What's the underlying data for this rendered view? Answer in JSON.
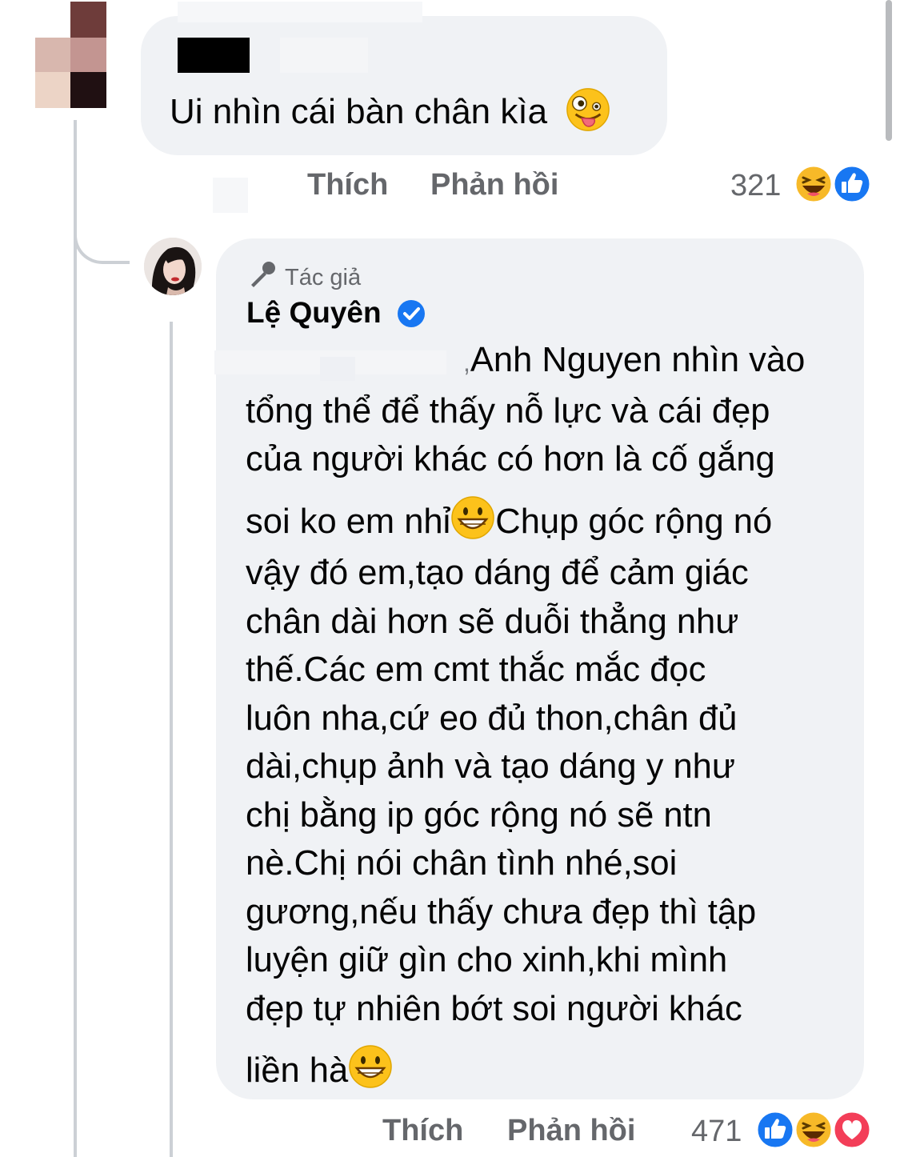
{
  "comment1": {
    "text": "Ui nhìn cái bàn chân kìa",
    "emoji": "zany-face",
    "actions": {
      "like": "Thích",
      "reply": "Phản hồi"
    },
    "reaction_count": "321",
    "reactions": [
      "haha",
      "like"
    ]
  },
  "reply": {
    "author_badge": "Tác giả",
    "author_name": "Lệ Quyên",
    "verified": true,
    "mention": "Anh Nguyen",
    "text_lines": [
      " nhìn vào",
      "tổng thể để thấy nỗ lực và cái đẹp",
      "của người khác có hơn là cố gắng",
      "soi ko em nhỉ",
      "Chụp góc rộng nó",
      "vậy đó em,tạo dáng để cảm giác",
      "chân dài hơn sẽ duỗi thẳng như",
      "thế.Các em cmt thắc mắc đọc",
      "luôn nha,cứ eo đủ thon,chân đủ",
      "dài,chụp ảnh và tạo dáng y như",
      "chị bằng ip góc rộng nó sẽ ntn",
      "nè.Chị nói chân tình nhé,soi",
      "gương,nếu thấy chưa đẹp thì tập",
      "luyện giữ gìn cho xinh,khi mình",
      "đẹp tự nhiên bớt soi người khác",
      "liền hà"
    ],
    "actions": {
      "like": "Thích",
      "reply": "Phản hồi"
    },
    "reaction_count": "471",
    "reactions": [
      "like",
      "haha",
      "love"
    ]
  },
  "colors": {
    "bubble": "#f0f2f5",
    "meta_text": "#65676b",
    "like_blue": "#1877f2",
    "haha_yellow": "#f7b928",
    "love_red": "#f33e58"
  }
}
